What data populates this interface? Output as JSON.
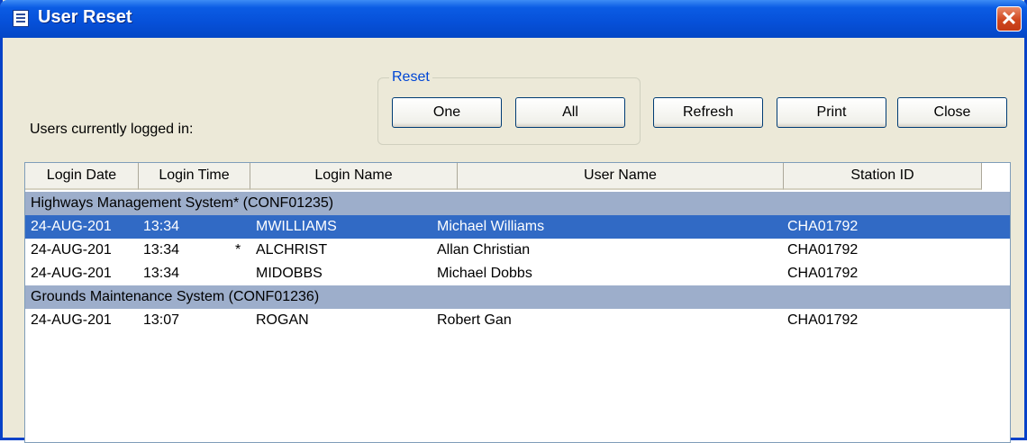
{
  "window": {
    "title": "User Reset"
  },
  "label": "Users currently logged in:",
  "reset_group": {
    "legend": "Reset",
    "one": "One",
    "all": "All"
  },
  "toolbar": {
    "refresh": "Refresh",
    "print": "Print",
    "close": "Close"
  },
  "columns": [
    "Login Date",
    "Login Time",
    "Login Name",
    "User Name",
    "Station ID"
  ],
  "groups": [
    {
      "name": "Highways Management System* (CONF01235)",
      "rows": [
        {
          "date": "24-AUG-201",
          "time": "13:34",
          "marker": "",
          "login": "MWILLIAMS",
          "user": "Michael Williams",
          "station": "CHA01792",
          "selected": true
        },
        {
          "date": "24-AUG-201",
          "time": "13:34",
          "marker": "*",
          "login": "ALCHRIST",
          "user": "Allan Christian",
          "station": "CHA01792",
          "selected": false
        },
        {
          "date": "24-AUG-201",
          "time": "13:34",
          "marker": "",
          "login": "MIDOBBS",
          "user": "Michael Dobbs",
          "station": "CHA01792",
          "selected": false
        }
      ]
    },
    {
      "name": "Grounds Maintenance System (CONF01236)",
      "rows": [
        {
          "date": "24-AUG-201",
          "time": "13:07",
          "marker": "",
          "login": "ROGAN",
          "user": "Robert Gan",
          "station": "CHA01792",
          "selected": false
        }
      ]
    }
  ]
}
